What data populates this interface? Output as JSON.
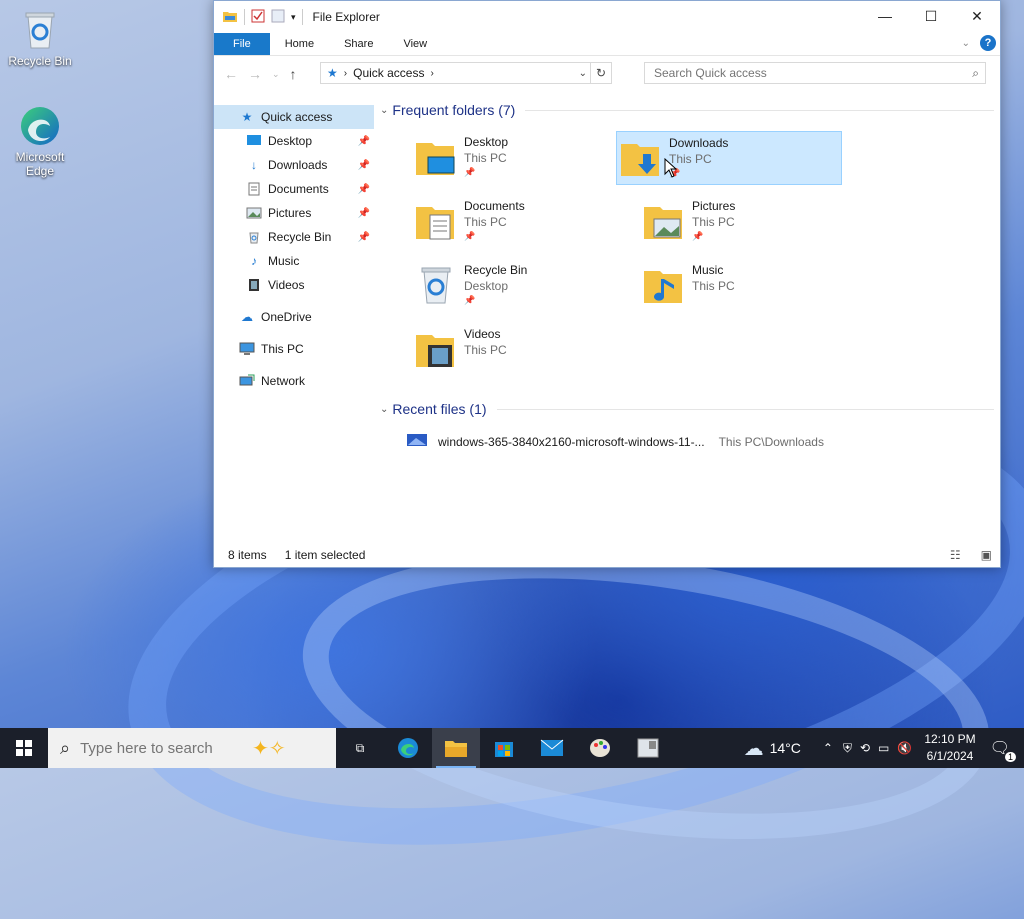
{
  "desktop": {
    "icons": [
      {
        "label": "Recycle Bin"
      },
      {
        "label": "Microsoft Edge"
      }
    ]
  },
  "window": {
    "title": "File Explorer",
    "ribbon_tabs": [
      "File",
      "Home",
      "Share",
      "View"
    ],
    "help_label": "?",
    "address": {
      "location": "Quick access"
    },
    "search": {
      "placeholder": "Search Quick access"
    }
  },
  "sidebar": {
    "items": [
      {
        "label": "Quick access",
        "icon": "star-icon",
        "selected": true
      },
      {
        "label": "Desktop",
        "icon": "desktop-icon",
        "pinned": true
      },
      {
        "label": "Downloads",
        "icon": "download-arrow-icon",
        "pinned": true
      },
      {
        "label": "Documents",
        "icon": "document-icon",
        "pinned": true
      },
      {
        "label": "Pictures",
        "icon": "pictures-icon",
        "pinned": true
      },
      {
        "label": "Recycle Bin",
        "icon": "recycle-bin-icon",
        "pinned": true
      },
      {
        "label": "Music",
        "icon": "music-note-icon"
      },
      {
        "label": "Videos",
        "icon": "film-icon"
      },
      {
        "label": "OneDrive",
        "icon": "cloud-icon"
      },
      {
        "label": "This PC",
        "icon": "monitor-icon"
      },
      {
        "label": "Network",
        "icon": "network-icon"
      }
    ]
  },
  "content": {
    "frequent_header": "Frequent folders (7)",
    "recent_header": "Recent files (1)",
    "folders": [
      {
        "name": "Desktop",
        "location": "This PC",
        "pinned": true,
        "selected": false
      },
      {
        "name": "Downloads",
        "location": "This PC",
        "pinned": true,
        "selected": true
      },
      {
        "name": "Documents",
        "location": "This PC",
        "pinned": true,
        "selected": false
      },
      {
        "name": "Pictures",
        "location": "This PC",
        "pinned": true,
        "selected": false
      },
      {
        "name": "Recycle Bin",
        "location": "Desktop",
        "pinned": true,
        "selected": false
      },
      {
        "name": "Music",
        "location": "This PC",
        "pinned": false,
        "selected": false
      },
      {
        "name": "Videos",
        "location": "This PC",
        "pinned": false,
        "selected": false
      }
    ],
    "recent_files": [
      {
        "name": "windows-365-3840x2160-microsoft-windows-11-...",
        "path": "This PC\\Downloads"
      }
    ]
  },
  "status": {
    "item_count": "8 items",
    "selection": "1 item selected"
  },
  "taskbar": {
    "search_placeholder": "Type here to search",
    "weather": "14°C",
    "time": "12:10 PM",
    "date": "6/1/2024",
    "notification_count": "1"
  },
  "colors": {
    "accent": "#1979ca",
    "selection": "#cce8ff",
    "header_blue": "#1e3287",
    "taskbar": "#1b1f2a"
  }
}
